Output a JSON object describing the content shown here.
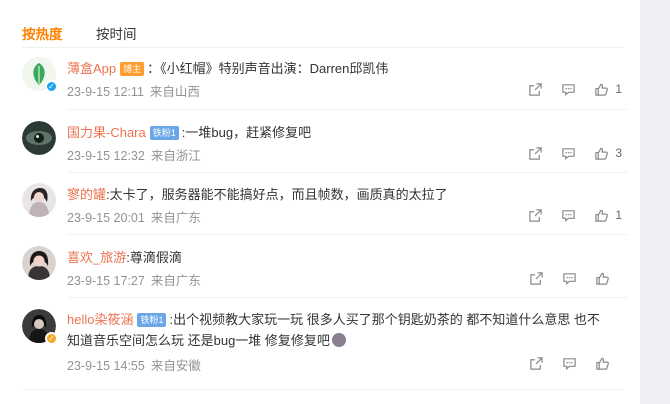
{
  "tabs": {
    "hot": "按热度",
    "time": "按时间"
  },
  "comments": [
    {
      "username": "薄盒App",
      "badge": "博主",
      "text": "：《小红帽》特别声音出演：Darren邱凯伟",
      "time": "23-9-15 12:11",
      "location": "来自山西",
      "likes": "1"
    },
    {
      "username": "国力果-Chara",
      "badge": "铁粉1",
      "text": ":一堆bug，赶紧修复吧",
      "time": "23-9-15 12:32",
      "location": "来自浙江",
      "likes": "3"
    },
    {
      "username": "寥的罐",
      "text": ":太卡了，服务器能不能搞好点，而且帧数，画质真的太拉了",
      "time": "23-9-15 20:01",
      "location": "来自广东",
      "likes": "1"
    },
    {
      "username": "喜欢_旅游",
      "text": ":尊滴假滴",
      "time": "23-9-15 17:27",
      "location": "来自广东",
      "likes": ""
    },
    {
      "username": "hello染筱涵",
      "badge": "铁粉1",
      "text_line1": ":出个视频教大家玩一玩 很多人买了那个钥匙奶茶的 都不知道什么意思 也不",
      "text_line2": "知道音乐空间怎么玩  还是bug一堆 修复修复吧",
      "time": "23-9-15 14:55",
      "location": "来自安徽",
      "likes": ""
    }
  ],
  "colors": {
    "accent": "#ff8200",
    "username": "#eb7350",
    "meta": "#939393"
  },
  "icons": [
    "share-icon",
    "comment-icon",
    "like-icon"
  ]
}
